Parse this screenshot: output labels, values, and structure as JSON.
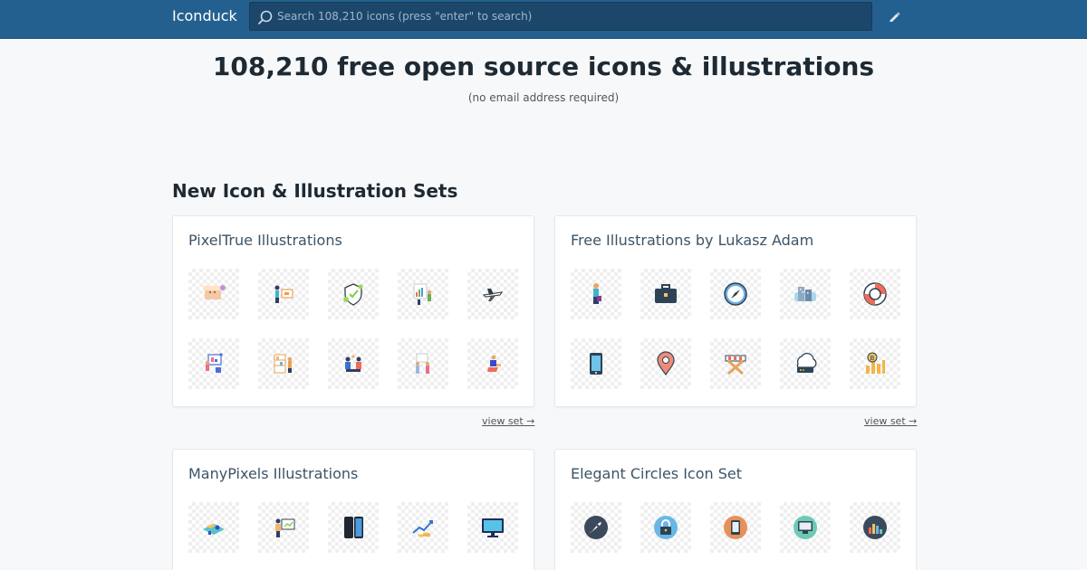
{
  "header": {
    "brand": "Iconduck",
    "search_placeholder": "Search 108,210 icons (press \"enter\" to search)"
  },
  "hero": {
    "title": "108,210 free open source icons & illustrations",
    "subtitle": "(no email address required)"
  },
  "section": {
    "title": "New Icon & Illustration Sets"
  },
  "sets": [
    {
      "title": "PixelTrue Illustrations",
      "view_label": "view set →"
    },
    {
      "title": "Free Illustrations by Lukasz Adam",
      "view_label": "view set →"
    },
    {
      "title": "ManyPixels Illustrations"
    },
    {
      "title": "Elegant Circles Icon Set"
    }
  ],
  "tile_icons": [
    [
      "box-illustration",
      "person-board-illustration",
      "shield-plant-illustration",
      "chart-people-illustration",
      "plane-illustration",
      "presenter-illustration",
      "shelves-people-illustration",
      "meeting-illustration",
      "team-standing-illustration",
      "person-sitting-illustration"
    ],
    [
      "man-standing-illustration",
      "briefcase-icon",
      "compass-icon",
      "city-illustration",
      "lifebuoy-icon",
      "smartphone-icon",
      "map-pin-icon",
      "barrier-icon",
      "cloud-server-icon",
      "bitcoin-chart-icon"
    ],
    [
      "isometric-map-illustration",
      "teacher-board-illustration",
      "phones-illustration",
      "growth-chart-illustration",
      "monitor-illustration"
    ],
    [
      "rocket-circle-icon",
      "lock-circle-icon",
      "tablet-circle-icon",
      "monitor-circle-icon",
      "bar-chart-circle-icon"
    ]
  ],
  "colors": {
    "header_bg": "#24608f",
    "search_bg": "#1c476b",
    "page_bg": "#f7f8fa"
  }
}
